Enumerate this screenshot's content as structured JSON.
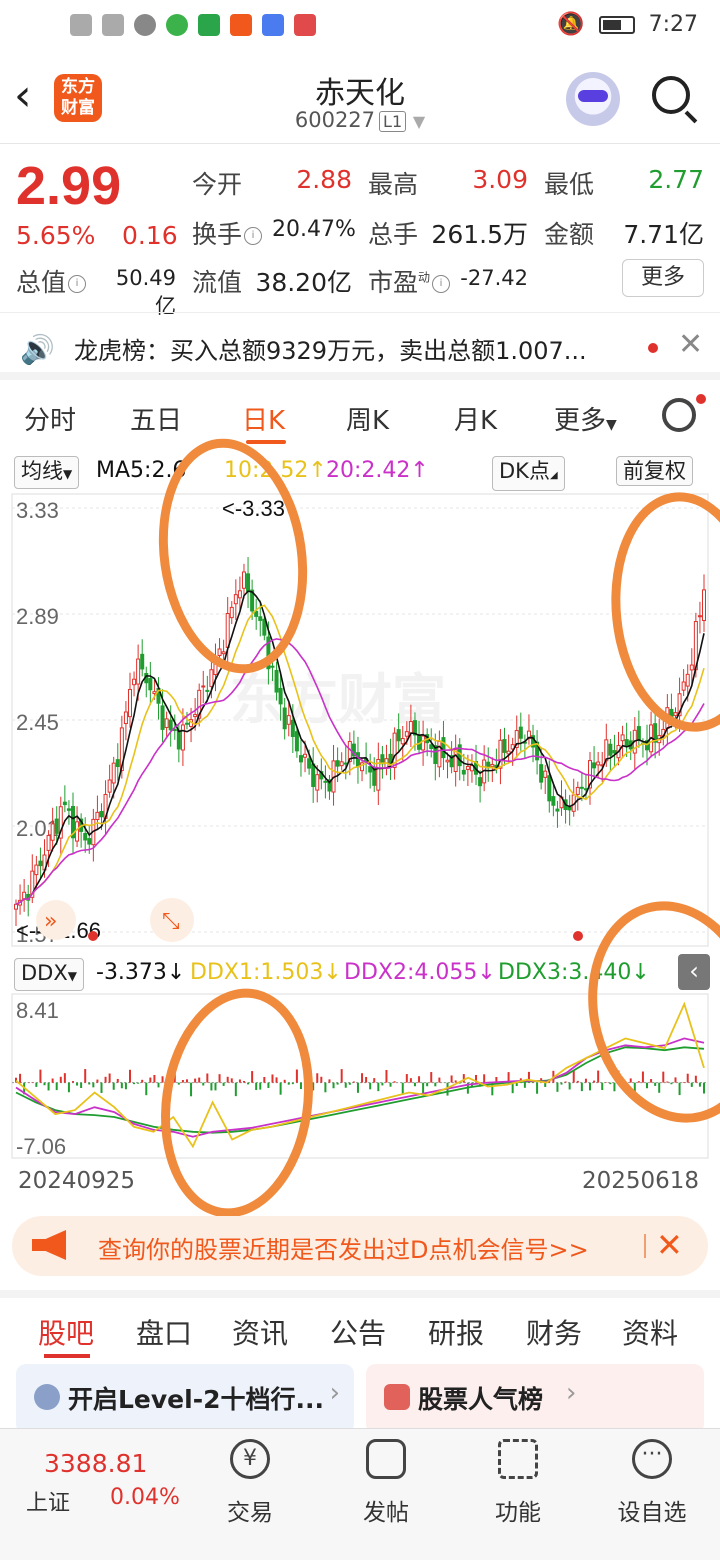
{
  "status": {
    "time": "7:27"
  },
  "header": {
    "title": "赤天化",
    "code": "600227",
    "level_badge": "L1",
    "logo_text": "东方财富"
  },
  "quote": {
    "price": "2.99",
    "pct": "5.65%",
    "chg": "0.16",
    "open_label": "今开",
    "open": "2.88",
    "high_label": "最高",
    "high": "3.09",
    "low_label": "最低",
    "low": "2.77",
    "turnover_label": "换手",
    "turnover": "20.47%",
    "volume_label": "总手",
    "volume": "261.5万",
    "amount_label": "金额",
    "amount": "7.71亿",
    "mktcap_label": "总值",
    "mktcap": "50.49亿",
    "float_label": "流值",
    "float": "38.20亿",
    "pe_label": "市盈",
    "pe_sup": "动",
    "pe": "-27.42",
    "more_label": "更多"
  },
  "notice": {
    "text": "龙虎榜：买入总额9329万元，卖出总额1.007..."
  },
  "ktabs": [
    "分时",
    "五日",
    "日K",
    "周K",
    "月K",
    "更多"
  ],
  "marow": {
    "ma_select": "均线",
    "ma5": "MA5:2.6",
    "ma10": "10:2.52↑",
    "ma20": "20:2.42↑",
    "dk": "DK点",
    "adjust": "前复权"
  },
  "kchart_labels": {
    "max_label": "<-3.33",
    "min_label": "<----1.66"
  },
  "ddxrow": {
    "select": "DDX",
    "ddx": "-3.373↓",
    "ddx1": "DDX1:1.503↓",
    "ddx2": "DDX2:4.055↓",
    "ddx3": "DDX3:3.440↓"
  },
  "chart_data": [
    {
      "type": "candlestick",
      "title": "",
      "y_ticks": [
        "3.33",
        "2.89",
        "2.45",
        "2.01",
        "1.57"
      ],
      "ylim": [
        1.57,
        3.33
      ],
      "series_names": [
        "MA5",
        "MA10",
        "MA20"
      ],
      "colors": {
        "up": "#e0322d",
        "down": "#1f9d2f",
        "ma5": "#111111",
        "ma10": "#e8c21a",
        "ma20": "#c931c9"
      },
      "close_path": [
        1.66,
        1.75,
        1.86,
        1.98,
        2.1,
        2.0,
        1.95,
        2.06,
        2.2,
        2.4,
        2.68,
        2.63,
        2.5,
        2.4,
        2.38,
        2.49,
        2.6,
        2.7,
        2.88,
        3.05,
        2.92,
        2.78,
        2.55,
        2.42,
        2.3,
        2.22,
        2.18,
        2.25,
        2.32,
        2.28,
        2.22,
        2.27,
        2.35,
        2.42,
        2.37,
        2.33,
        2.3,
        2.28,
        2.25,
        2.22,
        2.26,
        2.32,
        2.36,
        2.4,
        2.28,
        2.12,
        2.08,
        2.12,
        2.2,
        2.28,
        2.32,
        2.35,
        2.37,
        2.36,
        2.38,
        2.46,
        2.54,
        2.72,
        2.99
      ]
    },
    {
      "type": "line",
      "title": "",
      "y_ticks": [
        "8.41",
        "-7.06"
      ],
      "ylim": [
        -7.06,
        8.41
      ],
      "series_names": [
        "DDX1",
        "DDX2",
        "DDX3"
      ],
      "colors": {
        "ddx1": "#e8c21a",
        "ddx2": "#c931c9",
        "ddx3": "#1f9d2f"
      },
      "ddx1": [
        0.2,
        -1.5,
        -3.2,
        -2.8,
        -1.0,
        -2.5,
        -4.5,
        -5.0,
        -3.5,
        -6.5,
        -2.0,
        -5.8,
        -4.8,
        -4.5,
        -4.0,
        -3.5,
        -3.0,
        -2.5,
        -2.0,
        -1.5,
        -1.0,
        -1.3,
        -0.5,
        0.5,
        -0.4,
        -0.2,
        0.3,
        0.0,
        1.5,
        2.5,
        3.5,
        4.5,
        4.0,
        3.5,
        8.0,
        1.5
      ],
      "ddx2": [
        -0.5,
        -1.8,
        -3.0,
        -3.2,
        -2.5,
        -3.0,
        -4.2,
        -4.8,
        -5.0,
        -5.5,
        -5.0,
        -4.8,
        -4.6,
        -4.2,
        -3.8,
        -3.4,
        -3.0,
        -2.6,
        -2.2,
        -1.8,
        -1.4,
        -1.0,
        -0.6,
        -0.2,
        0.0,
        0.1,
        0.2,
        0.1,
        1.0,
        2.5,
        3.3,
        3.8,
        3.6,
        3.8,
        4.5,
        4.05
      ],
      "ddx3": [
        -1.0,
        -2.0,
        -2.8,
        -3.2,
        -3.3,
        -3.5,
        -4.0,
        -4.5,
        -4.8,
        -5.0,
        -5.1,
        -5.0,
        -4.8,
        -4.5,
        -4.1,
        -3.7,
        -3.3,
        -2.9,
        -2.5,
        -2.1,
        -1.7,
        -1.3,
        -0.9,
        -0.5,
        -0.2,
        0.0,
        0.1,
        0.2,
        0.8,
        2.0,
        3.0,
        3.6,
        3.5,
        3.3,
        3.6,
        3.44
      ],
      "x_start": "20240925",
      "x_end": "20250618"
    }
  ],
  "dates": {
    "start": "20240925",
    "end": "20250618"
  },
  "banner": {
    "text": "查询你的股票近期是否发出过D点机会信号>>"
  },
  "btabs": [
    "股吧",
    "盘口",
    "资讯",
    "公告",
    "研报",
    "财务",
    "资料"
  ],
  "cards": [
    {
      "title": "开启Level-2十档行..."
    },
    {
      "title": "股票人气榜"
    }
  ],
  "footer": {
    "index_value": "3388.81",
    "index_name": "上证",
    "index_pct": "0.04%",
    "items": [
      "交易",
      "发帖",
      "功能",
      "设自选"
    ]
  }
}
